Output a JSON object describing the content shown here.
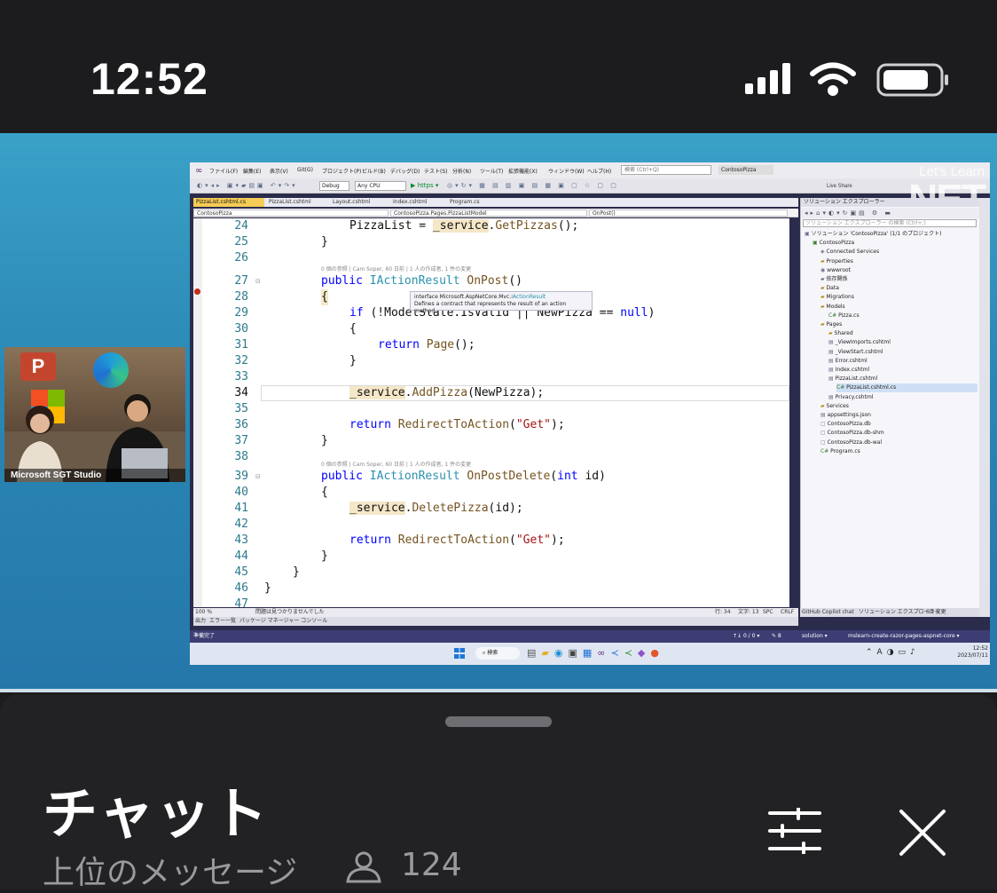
{
  "status_bar": {
    "time": "12:52"
  },
  "webcam": {
    "label": "Microsoft SGT Studio"
  },
  "vs": {
    "menu": [
      "ファイル(F)",
      "編集(E)",
      "表示(V)",
      "Git(G)",
      "プロジェクト(P)",
      "ビルド(B)",
      "デバッグ(D)",
      "テスト(S)",
      "分析(N)",
      "ツール(T)",
      "拡張機能(X)",
      "ウィンドウ(W)",
      "ヘルプ(H)"
    ],
    "search_placeholder": "検索 (Ctrl+Q)",
    "solution_name": "ContosoPizza",
    "toolbar": {
      "config": "Debug",
      "platform": "Any CPU",
      "run": "▶ https ▾"
    },
    "overlay": {
      "lets_learn": "Let's Learn",
      "net": "NET",
      "live_share": "Live Share"
    },
    "tabs": [
      "PizzaList.cshtml.cs",
      "PizzaList.cshtml",
      "Layout.cshtml",
      "Index.cshtml",
      "Program.cs"
    ],
    "nav": {
      "project": "ContosoPizza",
      "class": "ContosoPizza.Pages.PizzaListModel",
      "member": "OnPost()"
    },
    "tooltip": {
      "line1_prefix": "interface Microsoft.AspNetCore.Mvc.",
      "line1_name": "IActionResult",
      "line2": "Defines a contract that represents the result of an action method."
    },
    "codelens": {
      "onpost": "0 個の参照 | Cam Soper, 60 日前 | 1 人の作成者, 1 件の変更",
      "ondelete": "0 個の参照 | Cam Soper, 60 日前 | 1 人の作成者, 1 件の変更"
    },
    "line_numbers": [
      "24",
      "25",
      "26",
      "27",
      "28",
      "29",
      "30",
      "31",
      "32",
      "33",
      "34",
      "35",
      "36",
      "37",
      "38",
      "39",
      "40",
      "41",
      "42",
      "43",
      "44",
      "45",
      "46",
      "47"
    ],
    "code": {
      "l24_a": "PizzaList = ",
      "l24_b": "_service",
      "l24_c": ".",
      "l24_d": "GetPizzas",
      "l24_e": "();",
      "l25": "}",
      "l27_kw": "public ",
      "l27_type": "IActionResult ",
      "l27_method": "OnPost",
      "l27_rest": "()",
      "l28": "{",
      "l29_kw": "if ",
      "l29_rest": "(!ModelState.IsValid || NewPizza == ",
      "l29_null": "null",
      "l29_end": ")",
      "l30": "{",
      "l31_kw": "return ",
      "l31_method": "Page",
      "l31_rest": "();",
      "l32": "}",
      "l34_a": "_service",
      "l34_b": ".",
      "l34_c": "AddPizza",
      "l34_d": "(NewPizza);",
      "l36_kw": "return ",
      "l36_method": "RedirectToAction",
      "l36_a": "(",
      "l36_str": "\"Get\"",
      "l36_b": ");",
      "l37": "}",
      "l39_kw": "public ",
      "l39_type": "IActionResult ",
      "l39_method": "OnPostDelete",
      "l39_a": "(",
      "l39_int": "int ",
      "l39_b": "id)",
      "l40": "{",
      "l41_a": "_service",
      "l41_b": ".",
      "l41_c": "DeletePizza",
      "l41_d": "(id);",
      "l43_kw": "return ",
      "l43_method": "RedirectToAction",
      "l43_a": "(",
      "l43_str": "\"Get\"",
      "l43_b": ");",
      "l44": "}",
      "l45": "}",
      "l46": "}"
    },
    "editor_status": {
      "zoom": "100 %",
      "issues": "問題は見つかりませんでした",
      "pos": "行: 34",
      "col": "文字: 13",
      "spc": "SPC",
      "crlf": "CRLF"
    },
    "output_tabs": [
      "出力",
      "エラー一覧",
      "パッケージ マネージャー コンソール"
    ],
    "solution_explorer": {
      "title": "ソリューション エクスプローラー",
      "search": "ソリューション エクスプローラー の検索 (Ctrl+;)",
      "items": [
        {
          "label": "ソリューション 'ContosoPizza' (1/1 のプロジェクト)",
          "indent": 0,
          "icon": "▣",
          "kind": "file"
        },
        {
          "label": "ContosoPizza",
          "indent": 1,
          "icon": "▣",
          "kind": "cs"
        },
        {
          "label": "Connected Services",
          "indent": 2,
          "icon": "◈",
          "kind": "file"
        },
        {
          "label": "Properties",
          "indent": 2,
          "icon": "▰",
          "kind": "folder"
        },
        {
          "label": "wwwroot",
          "indent": 2,
          "icon": "◉",
          "kind": "file"
        },
        {
          "label": "依存関係",
          "indent": 2,
          "icon": "▰",
          "kind": "file"
        },
        {
          "label": "Data",
          "indent": 2,
          "icon": "▰",
          "kind": "folder"
        },
        {
          "label": "Migrations",
          "indent": 2,
          "icon": "▰",
          "kind": "folder"
        },
        {
          "label": "Models",
          "indent": 2,
          "icon": "▰",
          "kind": "folder"
        },
        {
          "label": "Pizza.cs",
          "indent": 3,
          "icon": "C#",
          "kind": "cs"
        },
        {
          "label": "Pages",
          "indent": 2,
          "icon": "▰",
          "kind": "folder"
        },
        {
          "label": "Shared",
          "indent": 3,
          "icon": "▰",
          "kind": "folder"
        },
        {
          "label": "_ViewImports.cshtml",
          "indent": 3,
          "icon": "▤",
          "kind": "file"
        },
        {
          "label": "_ViewStart.cshtml",
          "indent": 3,
          "icon": "▤",
          "kind": "file"
        },
        {
          "label": "Error.cshtml",
          "indent": 3,
          "icon": "▤",
          "kind": "file"
        },
        {
          "label": "Index.cshtml",
          "indent": 3,
          "icon": "▤",
          "kind": "file"
        },
        {
          "label": "PizzaList.cshtml",
          "indent": 3,
          "icon": "▤",
          "kind": "file"
        },
        {
          "label": "PizzaList.cshtml.cs",
          "indent": 4,
          "icon": "C#",
          "kind": "cs",
          "selected": true
        },
        {
          "label": "Privacy.cshtml",
          "indent": 3,
          "icon": "▤",
          "kind": "file"
        },
        {
          "label": "Services",
          "indent": 2,
          "icon": "▰",
          "kind": "folder"
        },
        {
          "label": "appsettings.json",
          "indent": 2,
          "icon": "▤",
          "kind": "file"
        },
        {
          "label": "ContosoPizza.db",
          "indent": 2,
          "icon": "▢",
          "kind": "file"
        },
        {
          "label": "ContosoPizza.db-shm",
          "indent": 2,
          "icon": "▢",
          "kind": "file"
        },
        {
          "label": "ContosoPizza.db-wal",
          "indent": 2,
          "icon": "▢",
          "kind": "file"
        },
        {
          "label": "Program.cs",
          "indent": 2,
          "icon": "C#",
          "kind": "cs"
        }
      ],
      "bottom_tabs": [
        "GitHub Copilot chat",
        "ソリューション エクスプローラー",
        "Git 変更"
      ]
    },
    "statusbar": {
      "ready": "準備完了",
      "errors": "↑↓ 0 / 0 ▾",
      "edits": "✎ 8",
      "branch": "solution ▾",
      "repo": "mslearn-create-razor-pages-aspnet-core ▾"
    },
    "taskbar": {
      "search": "検索",
      "time": "12:52",
      "date": "2023/07/11"
    }
  },
  "chat": {
    "title": "チャット",
    "subtitle": "上位のメッセージ",
    "viewers": "124"
  },
  "colors": {
    "accent_tab": "#f5cc55",
    "vs_status": "#3d3d74",
    "video_bg": "#2a87b4"
  }
}
